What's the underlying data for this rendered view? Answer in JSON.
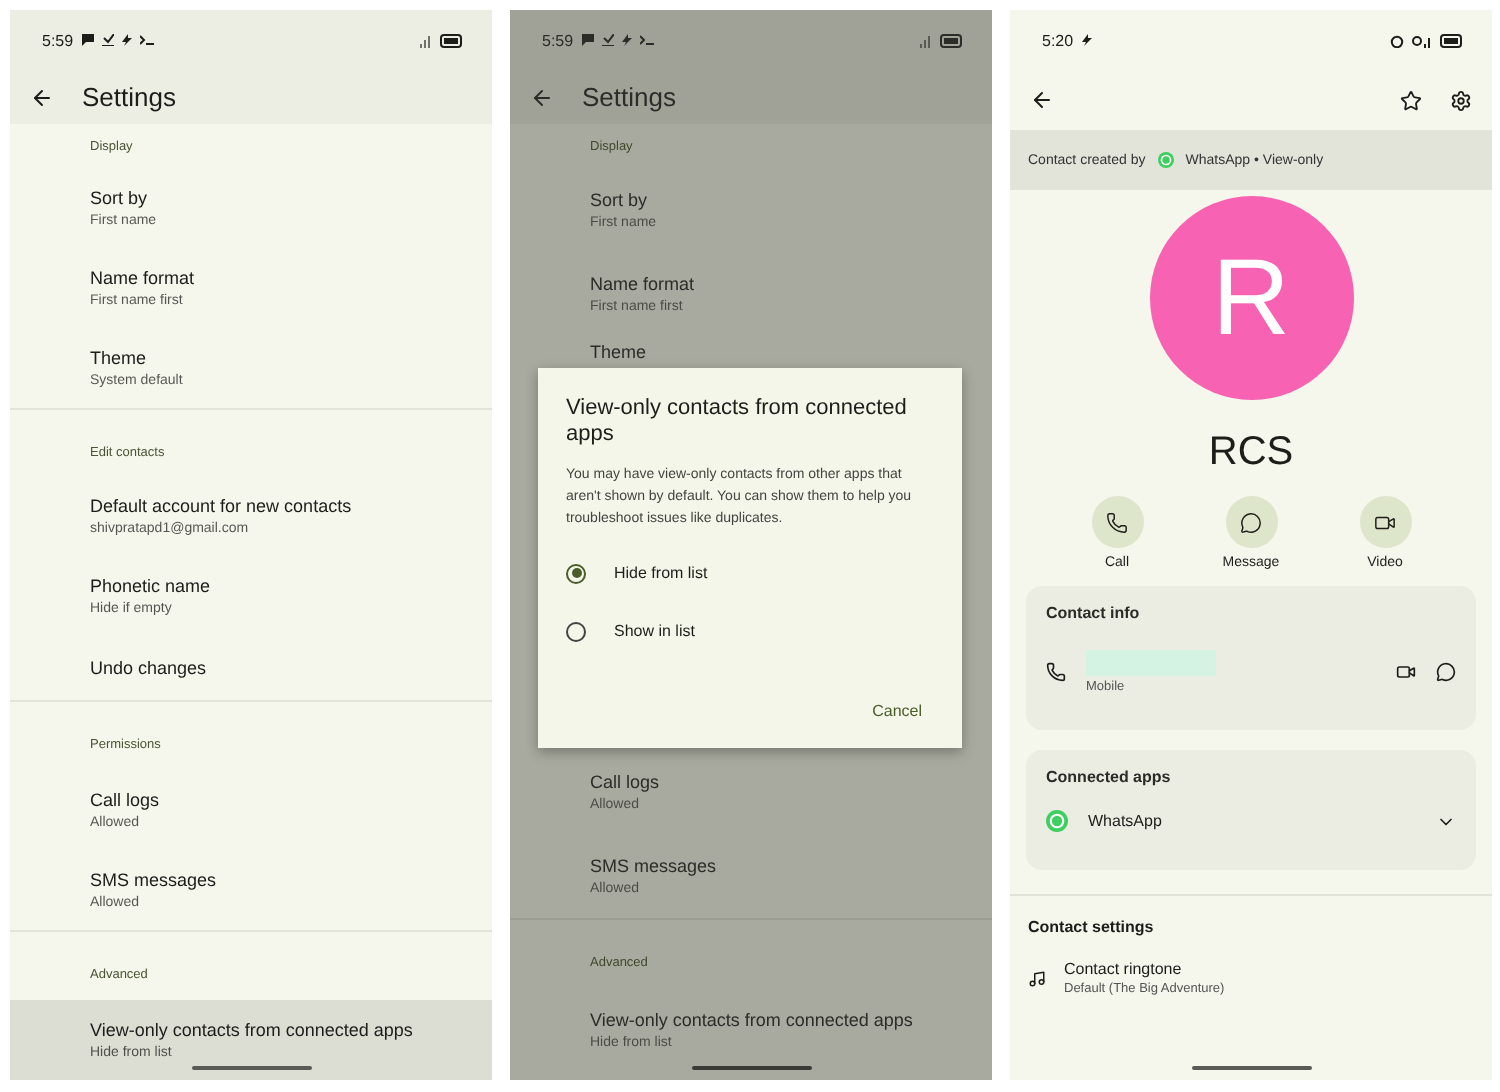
{
  "settings_screen": {
    "status_bar": {
      "time": "5:59"
    },
    "app_bar": {
      "title": "Settings"
    },
    "sections": [
      {
        "header": "Display",
        "items": [
          {
            "title": "Sort by",
            "subtitle": "First name",
            "selected": false
          },
          {
            "title": "Name format",
            "subtitle": "First name first",
            "selected": false
          },
          {
            "title": "Theme",
            "subtitle": "System default",
            "selected": false
          }
        ]
      },
      {
        "header": "Edit contacts",
        "items": [
          {
            "title": "Default account for new contacts",
            "subtitle": "shivpratapd1@gmail.com",
            "selected": false
          },
          {
            "title": "Phonetic name",
            "subtitle": "Hide if empty",
            "selected": false
          },
          {
            "title": "Undo changes",
            "selected": false
          }
        ]
      },
      {
        "header": "Permissions",
        "items": [
          {
            "title": "Call logs",
            "subtitle": "Allowed",
            "selected": false
          },
          {
            "title": "SMS messages",
            "subtitle": "Allowed",
            "selected": false
          }
        ]
      },
      {
        "header": "Advanced",
        "items": [
          {
            "title": "View-only contacts from connected apps",
            "subtitle": "Hide from list",
            "selected": true
          }
        ]
      }
    ]
  },
  "dialog_screen": {
    "status_bar": {
      "time": "5:59"
    },
    "app_bar": {
      "title": "Settings"
    },
    "top_header": "Display",
    "top_items": [
      {
        "title": "Sort by",
        "subtitle": "First name"
      },
      {
        "title": "Name format",
        "subtitle": "First name first"
      },
      {
        "title": "Theme"
      }
    ],
    "bottom_items": [
      {
        "title": "Call logs",
        "subtitle": "Allowed"
      },
      {
        "title": "SMS messages",
        "subtitle": "Allowed"
      }
    ],
    "bottom_sections": [
      {
        "header": "Advanced",
        "items": [
          {
            "title": "View-only contacts from connected apps",
            "subtitle": "Hide from list"
          }
        ]
      }
    ],
    "dialog": {
      "title": "View-only contacts from connected apps",
      "message": "You may have view-only contacts from other apps that aren't shown by default. You can show them to help you troubleshoot issues like duplicates.",
      "options": [
        {
          "label": "Hide from list",
          "selected": true
        },
        {
          "label": "Show in list",
          "selected": false
        }
      ],
      "buttons": [
        "Cancel"
      ]
    }
  },
  "contact_screen": {
    "status_bar": {
      "time": "5:20"
    },
    "banner": {
      "prefix": "Contact created by",
      "source": "WhatsApp • View-only"
    },
    "avatar": {
      "letter": "R",
      "color": "#f762b2"
    },
    "name": "RCS",
    "actions": [
      {
        "kind": "call",
        "label": "Call"
      },
      {
        "kind": "message",
        "label": "Message"
      },
      {
        "kind": "video",
        "label": "Video"
      }
    ],
    "contact_info": {
      "title": "Contact info",
      "phone_label": "Mobile"
    },
    "connected_apps": {
      "title": "Connected apps",
      "apps": [
        {
          "name": "WhatsApp",
          "expanded": false
        }
      ]
    },
    "contact_settings": {
      "title": "Contact settings",
      "items": [
        {
          "title": "Contact ringtone",
          "subtitle": "Default (The Big Adventure)"
        }
      ]
    }
  }
}
